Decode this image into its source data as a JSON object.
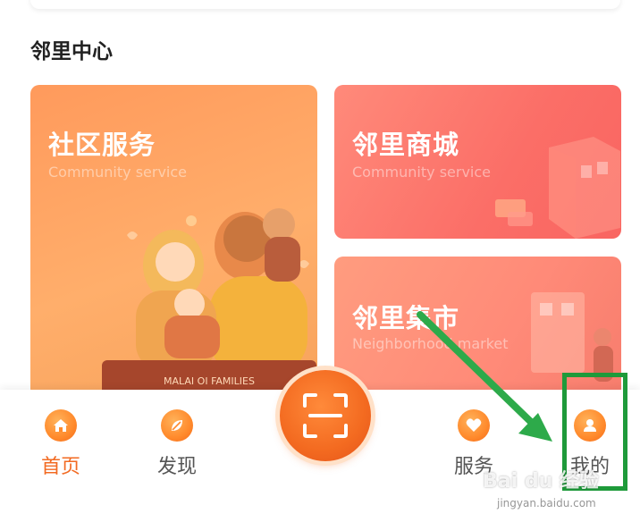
{
  "section": {
    "title": "邻里中心"
  },
  "cards": {
    "community": {
      "title": "社区服务",
      "subtitle": "Community service"
    },
    "mall": {
      "title": "邻里商城",
      "subtitle": "Community service"
    },
    "market": {
      "title": "邻里集市",
      "subtitle": "Neighborhood market",
      "illustration_text": "MALAI OI FAMILIES"
    }
  },
  "nav": {
    "home": {
      "label": "首页",
      "icon": "home-icon"
    },
    "discover": {
      "label": "发现",
      "icon": "leaf-icon"
    },
    "scan": {
      "icon": "scan-icon"
    },
    "services": {
      "label": "服务",
      "icon": "heart-icon"
    },
    "mine": {
      "label": "我的",
      "icon": "user-icon"
    }
  },
  "colors": {
    "accent": "#f26a22",
    "annotation": "#1e9a3a"
  },
  "watermark": {
    "text": "Bai du 经验",
    "sub": "jingyan.baidu.com"
  }
}
